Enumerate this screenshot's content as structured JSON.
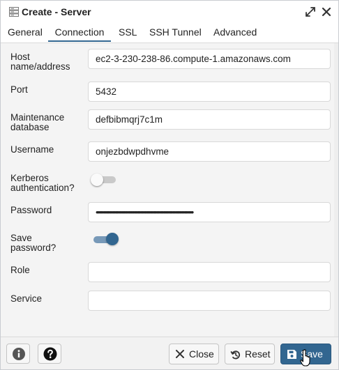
{
  "window": {
    "title": "Create - Server",
    "icons": {
      "app": "server-icon",
      "maximize": "expand-icon",
      "close": "close-icon"
    }
  },
  "tabs": [
    {
      "label": "General",
      "active": false
    },
    {
      "label": "Connection",
      "active": true
    },
    {
      "label": "SSL",
      "active": false
    },
    {
      "label": "SSH Tunnel",
      "active": false
    },
    {
      "label": "Advanced",
      "active": false
    }
  ],
  "form": {
    "host": {
      "label_line1": "Host",
      "label_line2": "name/address",
      "value": "ec2-3-230-238-86.compute-1.amazonaws.com"
    },
    "port": {
      "label": "Port",
      "value": "5432"
    },
    "maintenance_db": {
      "label_line1": "Maintenance",
      "label_line2": "database",
      "value": "defbibmqrj7c1m"
    },
    "username": {
      "label": "Username",
      "value": "onjezbdwpdhvme"
    },
    "kerberos": {
      "label_line1": "Kerberos",
      "label_line2": "authentication?",
      "enabled": false
    },
    "password": {
      "label": "Password",
      "masked_value": "••••••••••••••••••••••••••••••••••••••••••••••••••••••••••••••••••"
    },
    "save_password": {
      "label_line1": "Save",
      "label_line2": "password?",
      "enabled": true
    },
    "role": {
      "label": "Role",
      "value": ""
    },
    "service": {
      "label": "Service",
      "value": ""
    }
  },
  "footer": {
    "info_icon": "info-icon",
    "help_icon": "help-icon",
    "close_label": "Close",
    "reset_label": "Reset",
    "save_label": "Save"
  },
  "colors": {
    "accent": "#326690",
    "toggle_on_track": "#7799b8",
    "toggle_off_track": "#c9c9c9",
    "panel_background": "#f4f4f4"
  }
}
